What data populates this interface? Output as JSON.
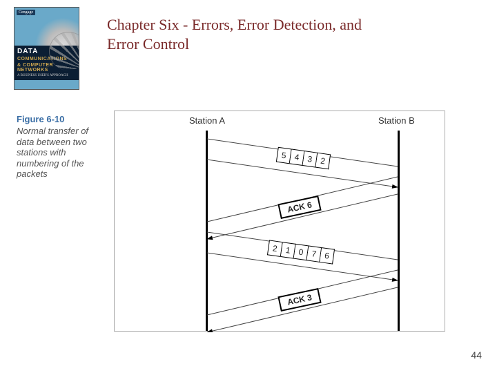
{
  "book_cover": {
    "brand": "Cengage",
    "title_line1": "DATA",
    "title_line2": "COMMUNICATIONS",
    "title_line3": "& COMPUTER NETWORKS",
    "subtitle": "A BUSINESS USER'S APPROACH"
  },
  "slide": {
    "title": "Chapter Six - Errors, Error Detection, and Error Control"
  },
  "figure": {
    "number": "Figure 6-10",
    "description": "Normal transfer of data between two stations with numbering of the packets"
  },
  "diagram": {
    "station_a": "Station A",
    "station_b": "Station B",
    "frame1": [
      "5",
      "4",
      "3",
      "2"
    ],
    "ack1": "ACK 6",
    "frame2": [
      "2",
      "1",
      "0",
      "7",
      "6"
    ],
    "ack2": "ACK 3"
  },
  "page_number": "44"
}
